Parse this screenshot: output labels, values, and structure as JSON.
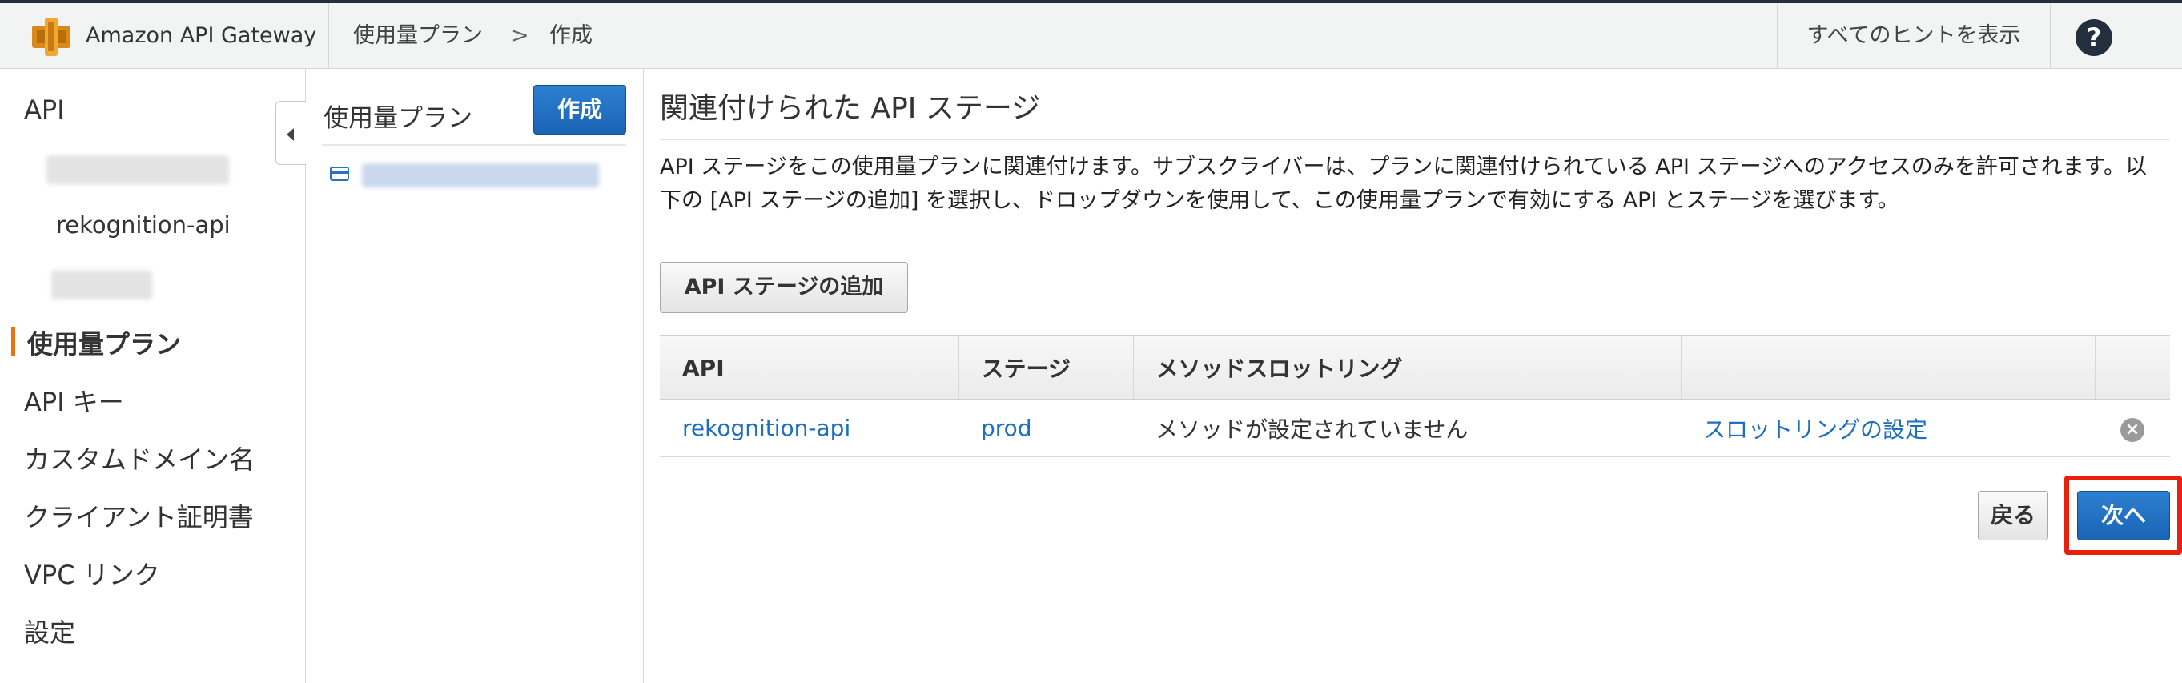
{
  "header": {
    "app_name": "Amazon API Gateway",
    "breadcrumb": {
      "section": "使用量プラン",
      "separator": ">",
      "current": "作成"
    },
    "hints_button": "すべてのヒントを表示",
    "help_icon_glyph": "?"
  },
  "leftnav": {
    "api_label": "API",
    "api_children": [
      "rekognition-api"
    ],
    "items": [
      "使用量プラン",
      "API キー",
      "カスタムドメイン名",
      "クライアント証明書",
      "VPC リンク",
      "設定"
    ],
    "active_item": "使用量プラン",
    "accent_color": "#ec7211"
  },
  "plans_panel": {
    "title": "使用量プラン",
    "create_button": "作成"
  },
  "main": {
    "title": "関連付けられた API ステージ",
    "description": "API ステージをこの使用量プランに関連付けます。サブスクライバーは、プランに関連付けられている API ステージへのアクセスのみを許可されます。以下の [API ステージの追加] を選択し、ドロップダウンを使用して、この使用量プランで有効にする API とステージを選びます。",
    "add_stage_button": "API ステージの追加",
    "table": {
      "headers": [
        "API",
        "ステージ",
        "メソッドスロットリング",
        "",
        ""
      ],
      "rows": [
        {
          "api": "rekognition-api",
          "stage": "prod",
          "method_throttling": "メソッドが設定されていません",
          "throttling_link": "スロットリングの設定",
          "remove_icon": "remove-circle-icon"
        }
      ]
    },
    "back_button": "戻る",
    "next_button": "次へ",
    "highlight_color": "#e8200c"
  }
}
